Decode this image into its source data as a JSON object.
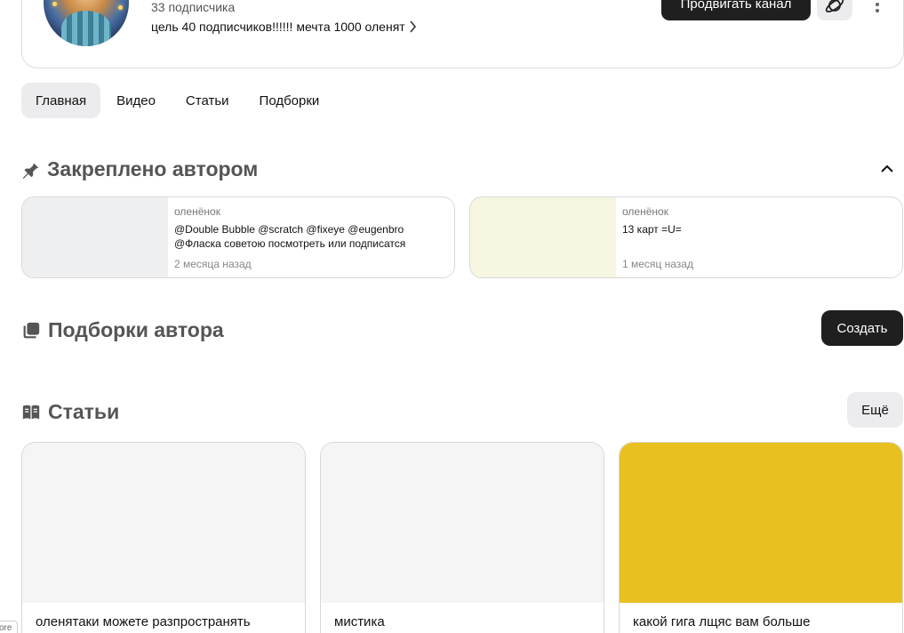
{
  "channel": {
    "subscribers": "33 подписчика",
    "description": "цель 40 подписчиков!!!!!! мечта 1000 оленят",
    "promote_label": "Продвигать канал"
  },
  "tabs": [
    {
      "label": "Главная",
      "active": true
    },
    {
      "label": "Видео",
      "active": false
    },
    {
      "label": "Статьи",
      "active": false
    },
    {
      "label": "Подборки",
      "active": false
    }
  ],
  "pinned": {
    "title": "Закреплено автором",
    "items": [
      {
        "author": "оленёнок",
        "text": "@Double Bubble @scratch @fixeye @eugenbro @Фласка советою посмотреть или подписатся",
        "time": "2 месяца назад",
        "thumb_color": "#eeeff1"
      },
      {
        "author": "оленёнок",
        "text": "13 карт =U=",
        "time": "1 месяц назад",
        "thumb_color": "#f6f6e1"
      }
    ]
  },
  "collections": {
    "title": "Подборки автора",
    "create_label": "Создать"
  },
  "articles": {
    "title": "Статьи",
    "more_label": "Ещё",
    "items": [
      {
        "title": "оленятаки можете разпространять",
        "cover_color": "#f5f5f5"
      },
      {
        "title": "мистика",
        "cover_color": "#f5f5f5"
      },
      {
        "title": "какой гига лщяс вам больше",
        "cover_color": "#e8c020"
      }
    ]
  },
  "corner_label": "ore",
  "colors": {
    "accent_dark": "#1f1f1f",
    "tab_active_bg": "#ececee",
    "section_title": "#555555"
  }
}
